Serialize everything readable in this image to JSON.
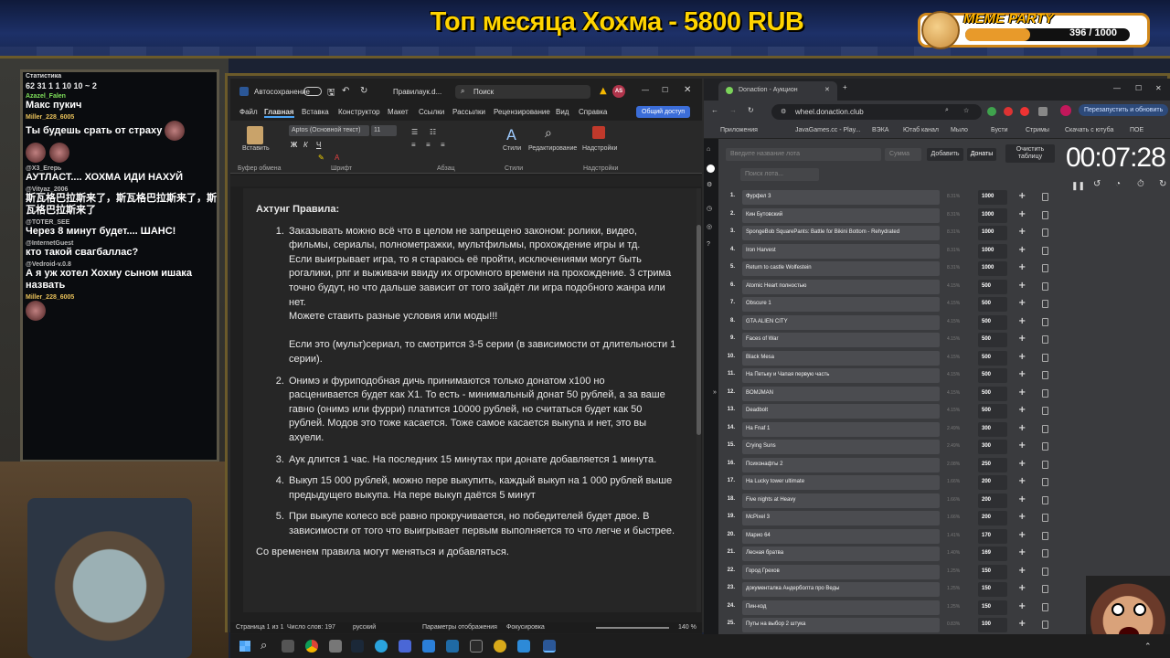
{
  "overlay": {
    "headline": "Топ месяца Хохма - 5800 RUB",
    "meme_title": "MEME PARTY",
    "meme_count": "396 / 1000",
    "meme_progress": 0.396
  },
  "chat": {
    "stats_label": "Статистика",
    "stats_row": "62  31  1  1  10  10  ~  2",
    "messages": [
      {
        "user": "Azazel_Falen",
        "text": "Макс пукич"
      },
      {
        "user": "Miller_228_6005",
        "text": "Ты будешь срать от страху"
      },
      {
        "user": "@X3_Егерь",
        "text": "АУТЛАСТ.... ХОХМА ИДИ НАХУЙ"
      },
      {
        "user": "@Vityaz_2006",
        "text": "斯瓦格巴拉斯来了，斯瓦格巴拉斯来了，斯瓦格巴拉斯来了"
      },
      {
        "user": "@TOTER_SEE",
        "text": "Через 8 минут будет.... ШАНС!"
      },
      {
        "user": "@InternetGuest",
        "text": "кто такой свагбаллас?"
      },
      {
        "user": "@Vedroid-v.0.8",
        "text": "А я уж хотел Хохму сыном ишака назвать"
      },
      {
        "user": "Miller_228_6005",
        "text": ""
      }
    ]
  },
  "word": {
    "autosave": "Автосохранение",
    "filename": "Правилаук.d...",
    "search": "Поиск",
    "avatar": "AS",
    "tabs": [
      "Файл",
      "Главная",
      "Вставка",
      "Конструктор",
      "Макет",
      "Ссылки",
      "Рассылки",
      "Рецензирование",
      "Вид",
      "Справка"
    ],
    "share": "Общий доступ",
    "font": "Aptos (Основной текст)",
    "size": "11",
    "paste": "Вставить",
    "styles": "Стили",
    "editing": "Редактирование",
    "addins": "Надстройки",
    "groups": [
      "Буфер обмена",
      "Шрифт",
      "Абзац",
      "Стили",
      "Надстройки"
    ],
    "doc_title": "Ахтунг Правила:",
    "rules": [
      "Заказывать можно всё что в целом не запрещено законом: ролики, видео, фильмы, сериалы, полнометражки, мультфильмы, прохождение игры и тд.",
      "Онимэ и фуриподобная дичь принимаются только донатом x100 но расценивается будет как X1. То есть - минимальный донат 50 рублей, а за ваше гавно (онимэ или фурри) платится 10000 рублей, но считаться будет как 50 рублей. Модов это тоже касается. Тоже самое касается выкупа и нет, это вы ахуели.",
      "Аук длится 1 час. На последних 15 минутах при донате добавляется 1 минута.",
      "Выкуп 15 000 рублей, можно пере выкупить, каждый выкуп на 1 000 рублей выше предыдущего выкупа. На пере выкуп даётся 5 минут",
      "При выкупе колесо всё равно прокручивается, но победителей будет двое. В зависимости от того что выигрывает первым выполняется то что легче и быстрее."
    ],
    "rule1_extra": "Если выигрывает игра, то я стараюсь её пройти, исключениями могут быть рогалики, рпг и выживачи ввиду их огромного времени на прохождение. 3 стрима точно будут, но что дальше зависит от того зайдёт ли игра подобного жанра или нет.",
    "rule1_extra2": "Можете ставить разные условия или моды!!!",
    "rule1_extra3": "Если это (мульт)сериал, то смотрится 3-5 серии (в зависимости от длительности 1 серии).",
    "footer": "Со временем правила могут меняться и добавляться.",
    "status": {
      "page": "Страница 1 из 1",
      "words": "Число слов: 197",
      "lang": "русский",
      "display": "Параметры отображения",
      "focus": "Фокусировка",
      "zoom": "140 %"
    }
  },
  "browser": {
    "tab": "Donaction - Аукцион",
    "url": "wheel.donaction.club",
    "restart": "Перезапустить и обновить",
    "bookmarks": [
      "Приложения",
      "JavaGames.cc - Play...",
      "ВЭКА",
      "Ютаб канал",
      "Мыло",
      "Бусти",
      "Стримы",
      "Скачать с ютуба",
      "ПОЕ"
    ],
    "lot_placeholder": "Введите название лота",
    "sum_placeholder": "Сумма",
    "add": "Добавить",
    "donates": "Донаты",
    "clear": "Очистить таблицу",
    "search_placeholder": "Поиск лота...",
    "timer": "00:07:28",
    "lots": [
      {
        "n": "1.",
        "name": "Фурфел 3",
        "pct": "8.31%",
        "amt": "1000"
      },
      {
        "n": "2.",
        "name": "Кин Бутовский",
        "pct": "8.31%",
        "amt": "1000"
      },
      {
        "n": "3.",
        "name": "SpongeBob SquarePants: Battle for Bikini Bottom - Rehydrated",
        "pct": "8.31%",
        "amt": "1000"
      },
      {
        "n": "4.",
        "name": "Iron Harvest",
        "pct": "8.31%",
        "amt": "1000"
      },
      {
        "n": "5.",
        "name": "Return to castle Wolfestein",
        "pct": "8.31%",
        "amt": "1000"
      },
      {
        "n": "6.",
        "name": "Atomic Heart полностью",
        "pct": "4.15%",
        "amt": "500"
      },
      {
        "n": "7.",
        "name": "Obscure 1",
        "pct": "4.15%",
        "amt": "500"
      },
      {
        "n": "8.",
        "name": "GTA ALIEN CITY",
        "pct": "4.15%",
        "amt": "500"
      },
      {
        "n": "9.",
        "name": "Faces of War",
        "pct": "4.15%",
        "amt": "500"
      },
      {
        "n": "10.",
        "name": "Black Mesa",
        "pct": "4.15%",
        "amt": "500"
      },
      {
        "n": "11.",
        "name": "На Петьку и Чапая первую часть",
        "pct": "4.15%",
        "amt": "500"
      },
      {
        "n": "12.",
        "name": "BOMJMAN",
        "pct": "4.15%",
        "amt": "500"
      },
      {
        "n": "13.",
        "name": "Deadbolt",
        "pct": "4.15%",
        "amt": "500"
      },
      {
        "n": "14.",
        "name": "На Fnaf 1",
        "pct": "2.49%",
        "amt": "300"
      },
      {
        "n": "15.",
        "name": "Crying Suns",
        "pct": "2.49%",
        "amt": "300"
      },
      {
        "n": "16.",
        "name": "Психонафты 2",
        "pct": "2.08%",
        "amt": "250"
      },
      {
        "n": "17.",
        "name": "На Lucky tower ultimate",
        "pct": "1.66%",
        "amt": "200"
      },
      {
        "n": "18.",
        "name": "Five nights at Heavy",
        "pct": "1.66%",
        "amt": "200"
      },
      {
        "n": "19.",
        "name": "McPixel 3",
        "pct": "1.66%",
        "amt": "200"
      },
      {
        "n": "20.",
        "name": "Марио 64",
        "pct": "1.41%",
        "amt": "170"
      },
      {
        "n": "21.",
        "name": "Лесная братва",
        "pct": "1.40%",
        "amt": "169"
      },
      {
        "n": "22.",
        "name": "Город Грехов",
        "pct": "1.25%",
        "amt": "150"
      },
      {
        "n": "23.",
        "name": "документалка Андерболта про Веды",
        "pct": "1.25%",
        "amt": "150"
      },
      {
        "n": "24.",
        "name": "Пин-код",
        "pct": "1.25%",
        "amt": "150"
      },
      {
        "n": "25.",
        "name": "Путы на выбор 2 штука",
        "pct": "0.83%",
        "amt": "100"
      }
    ]
  }
}
